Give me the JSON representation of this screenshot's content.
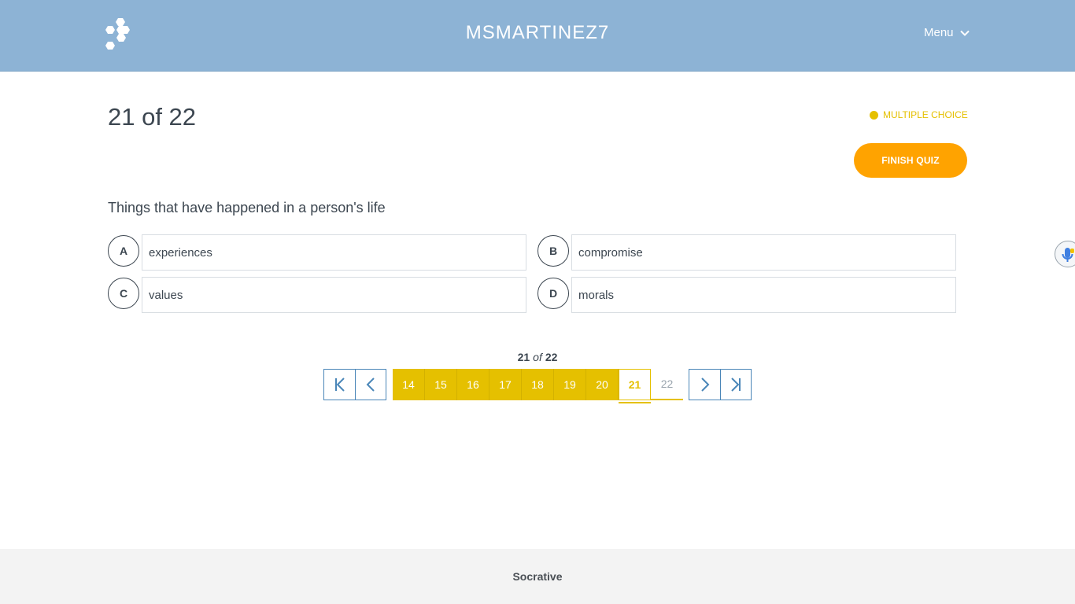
{
  "header": {
    "logo_icon": "socrative-hexagon-logo",
    "room_name": "MSMARTINEZ7",
    "menu_label": "Menu",
    "background": "#8db3d5"
  },
  "question": {
    "count_label": "21 of 22",
    "type_label": "MULTIPLE CHOICE",
    "type_color": "#e5c000",
    "finish_label": "FINISH QUIZ",
    "finish_color": "#ffa300",
    "text": "Things that have happened in a person's life"
  },
  "answers": [
    {
      "letter": "A",
      "text": "experiences"
    },
    {
      "letter": "B",
      "text": "compromise"
    },
    {
      "letter": "C",
      "text": "values"
    },
    {
      "letter": "D",
      "text": "morals"
    }
  ],
  "pagination": {
    "current": "21",
    "of_word": "of",
    "total": "22",
    "pages": [
      {
        "label": "14",
        "state": "answered"
      },
      {
        "label": "15",
        "state": "answered"
      },
      {
        "label": "16",
        "state": "answered"
      },
      {
        "label": "17",
        "state": "answered"
      },
      {
        "label": "18",
        "state": "answered"
      },
      {
        "label": "19",
        "state": "answered"
      },
      {
        "label": "20",
        "state": "answered"
      },
      {
        "label": "21",
        "state": "current"
      },
      {
        "label": "22",
        "state": "unanswered"
      }
    ],
    "nav_icons": [
      "first-page-icon",
      "previous-page-icon",
      "next-page-icon",
      "last-page-icon"
    ]
  },
  "mic_icon": "microphone-icon",
  "footer": {
    "brand": "Socrative"
  }
}
